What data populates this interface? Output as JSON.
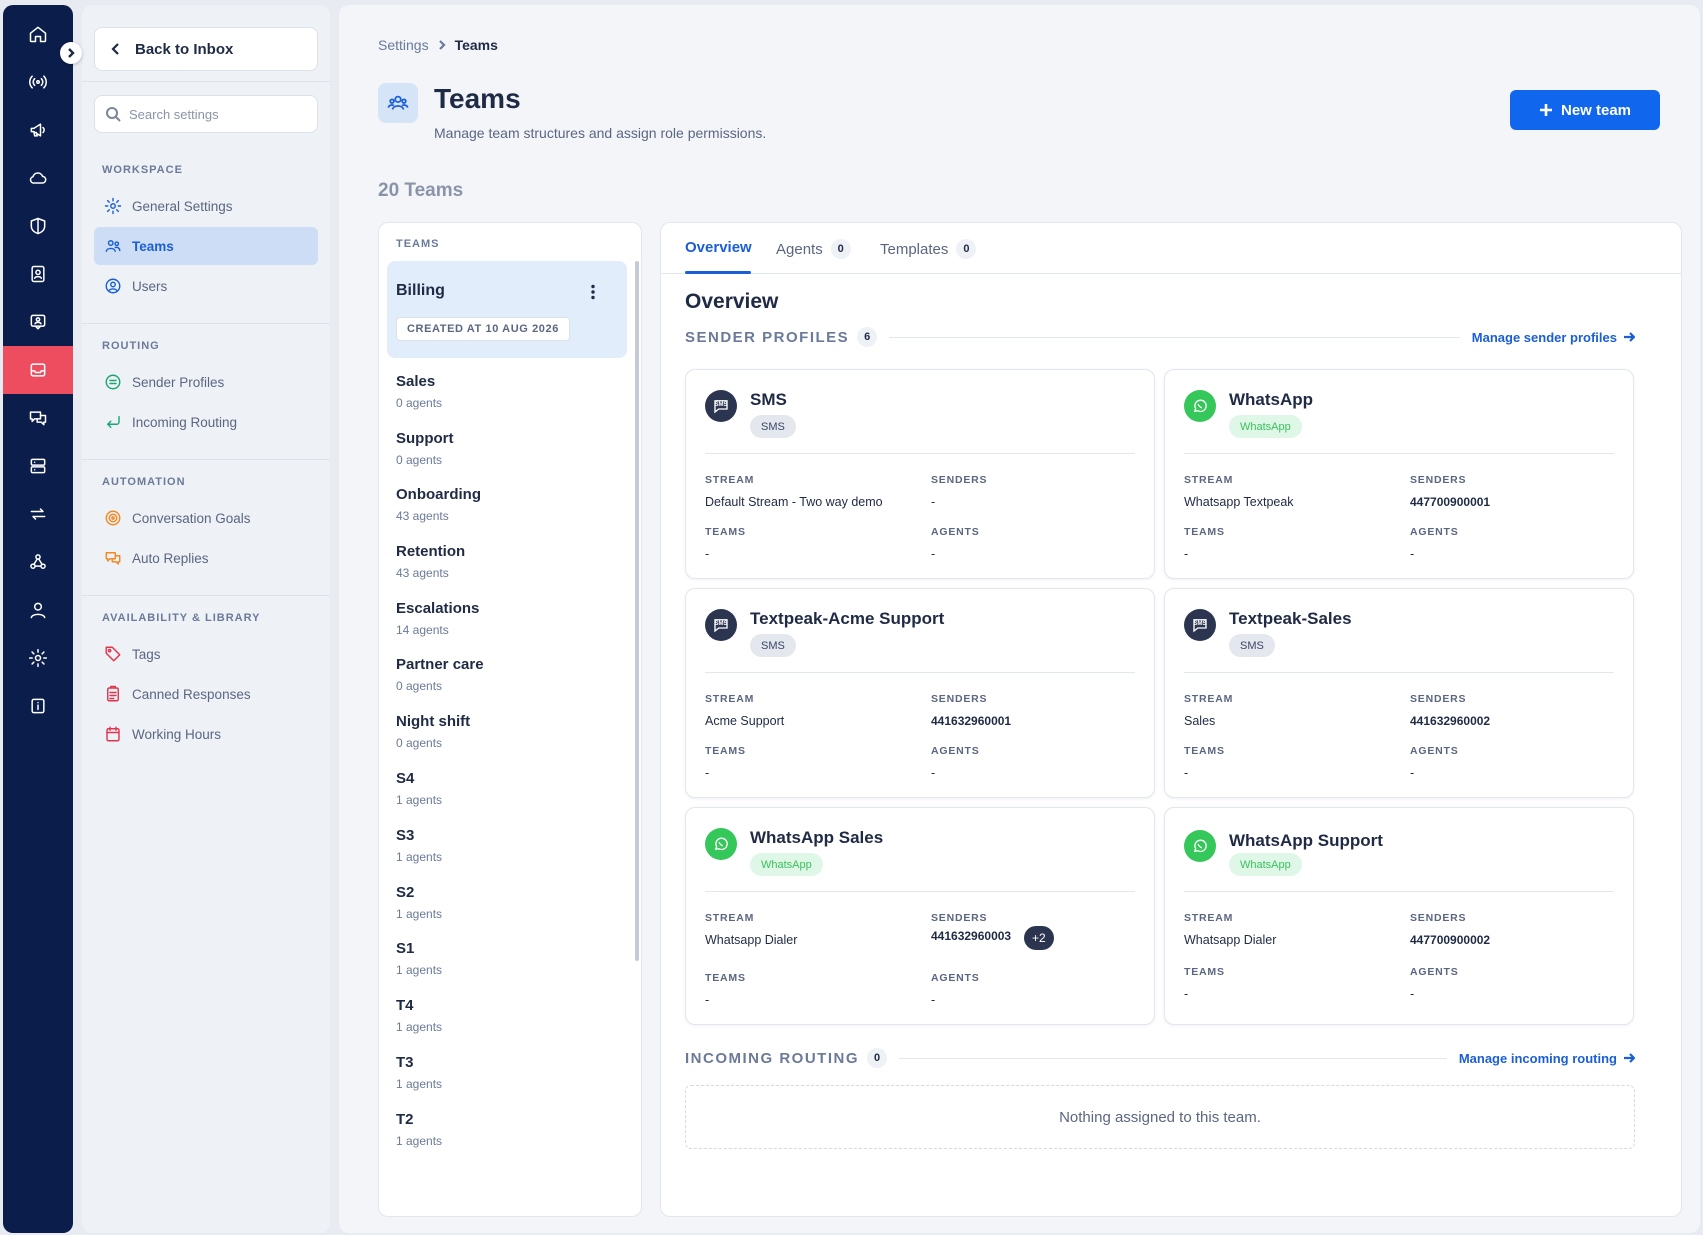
{
  "sidebar": {
    "back_label": "Back to Inbox",
    "search_placeholder": "Search settings",
    "sections": [
      {
        "label": "WORKSPACE",
        "items": [
          "General Settings",
          "Teams",
          "Users"
        ]
      },
      {
        "label": "ROUTING",
        "items": [
          "Sender Profiles",
          "Incoming Routing"
        ]
      },
      {
        "label": "AUTOMATION",
        "items": [
          "Conversation Goals",
          "Auto Replies"
        ]
      },
      {
        "label": "AVAILABILITY & LIBRARY",
        "items": [
          "Tags",
          "Canned Responses",
          "Working Hours"
        ]
      }
    ],
    "active_item": "Teams"
  },
  "breadcrumb": {
    "parent": "Settings",
    "current": "Teams"
  },
  "header": {
    "title": "Teams",
    "subtitle": "Manage team structures and assign role permissions.",
    "new_team_label": "New team"
  },
  "team_count": "20 Teams",
  "team_list": {
    "header": "TEAMS",
    "selected": {
      "name": "Billing",
      "created": "CREATED AT 10 AUG 2026"
    },
    "items": [
      {
        "name": "Sales",
        "agents": "0 agents"
      },
      {
        "name": "Support",
        "agents": "0 agents"
      },
      {
        "name": "Onboarding",
        "agents": "43 agents"
      },
      {
        "name": "Retention",
        "agents": "43 agents"
      },
      {
        "name": "Escalations",
        "agents": "14 agents"
      },
      {
        "name": "Partner care",
        "agents": "0 agents"
      },
      {
        "name": "Night shift",
        "agents": "0 agents"
      },
      {
        "name": "S4",
        "agents": "1 agents"
      },
      {
        "name": "S3",
        "agents": "1 agents"
      },
      {
        "name": "S2",
        "agents": "1 agents"
      },
      {
        "name": "S1",
        "agents": "1 agents"
      },
      {
        "name": "T4",
        "agents": "1 agents"
      },
      {
        "name": "T3",
        "agents": "1 agents"
      },
      {
        "name": "T2",
        "agents": "1 agents"
      }
    ]
  },
  "detail": {
    "tabs": [
      {
        "label": "Overview",
        "badge": ""
      },
      {
        "label": "Agents",
        "badge": "0"
      },
      {
        "label": "Templates",
        "badge": "0"
      }
    ],
    "overview_title": "Overview",
    "sender_profiles": {
      "label": "SENDER PROFILES",
      "count": "6",
      "link": "Manage sender profiles",
      "field_labels": {
        "stream": "STREAM",
        "senders": "SENDERS",
        "teams": "TEAMS",
        "agents": "AGENTS"
      },
      "cards": [
        {
          "name": "SMS",
          "type": "SMS",
          "stream": "Default Stream - Two way demo",
          "senders": "-",
          "teams": "-",
          "agents": "-",
          "extra": ""
        },
        {
          "name": "WhatsApp",
          "type": "WhatsApp",
          "stream": "Whatsapp Textpeak",
          "senders": "447700900001",
          "teams": "-",
          "agents": "-",
          "extra": ""
        },
        {
          "name": "Textpeak-Acme Support",
          "type": "SMS",
          "stream": "Acme Support",
          "senders": "441632960001",
          "teams": "-",
          "agents": "-",
          "extra": ""
        },
        {
          "name": "Textpeak-Sales",
          "type": "SMS",
          "stream": "Sales",
          "senders": "441632960002",
          "teams": "-",
          "agents": "-",
          "extra": ""
        },
        {
          "name": "WhatsApp Sales",
          "type": "WhatsApp",
          "stream": "Whatsapp Dialer",
          "senders": "441632960003",
          "teams": "-",
          "agents": "-",
          "extra": "+2"
        },
        {
          "name": "WhatsApp Support",
          "type": "WhatsApp",
          "stream": "Whatsapp Dialer",
          "senders": "447700900002",
          "teams": "-",
          "agents": "-",
          "extra": ""
        }
      ]
    },
    "incoming_routing": {
      "label": "INCOMING ROUTING",
      "count": "0",
      "link": "Manage incoming routing",
      "empty": "Nothing assigned to this team."
    }
  },
  "colors": {
    "primary": "#1166ee",
    "rail": "#0b1d4a",
    "rail_active": "#ee4d5f",
    "whatsapp": "#35c759"
  }
}
